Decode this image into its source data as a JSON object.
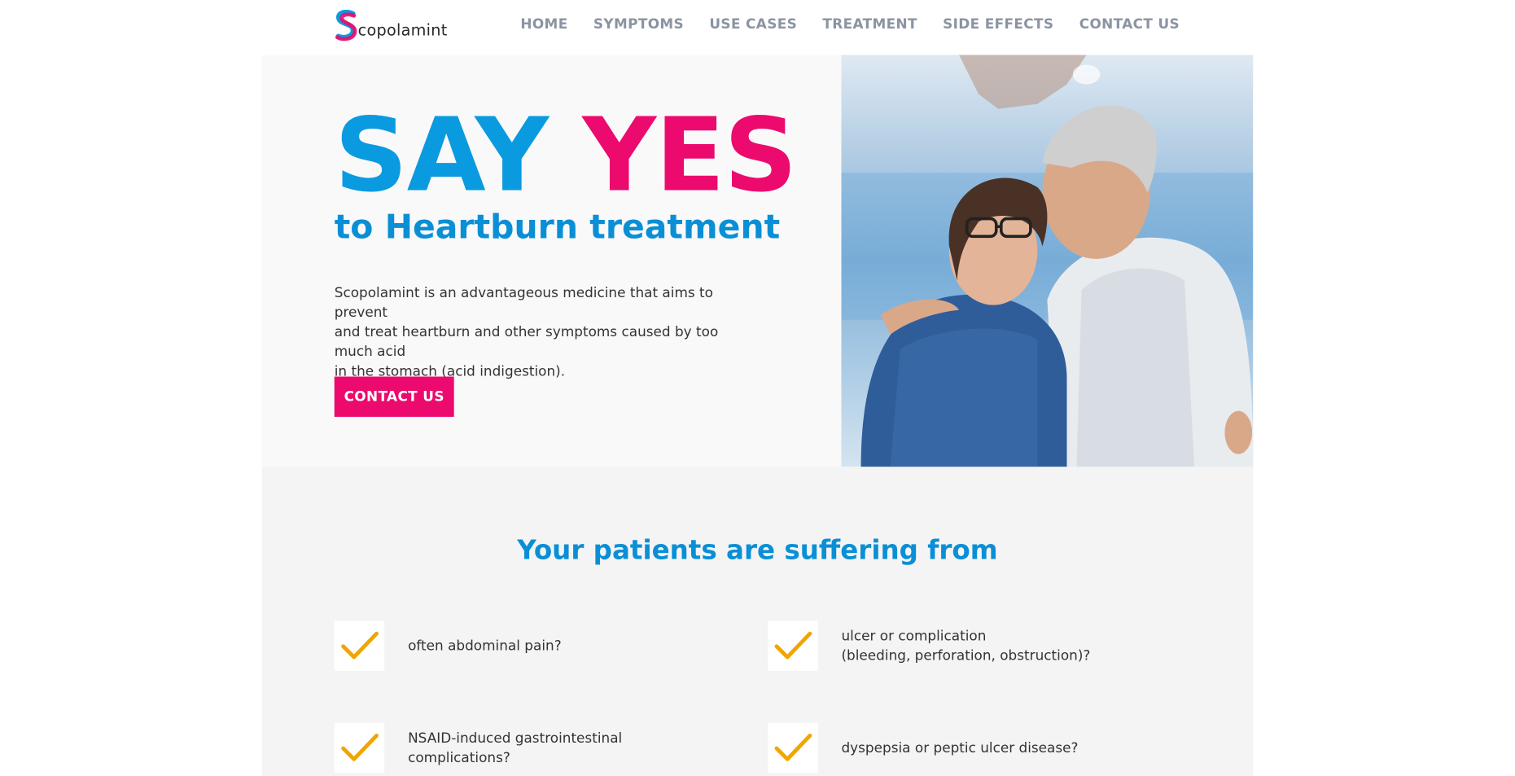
{
  "brand": {
    "name_rest": "copolamint",
    "colors": {
      "blue": "#0a9ae0",
      "pink": "#ec0a6e",
      "check": "#f0a500",
      "nav": "#8a94a2"
    }
  },
  "nav": {
    "items": [
      {
        "label": "HOME"
      },
      {
        "label": "SYMPTOMS"
      },
      {
        "label": "USE CASES"
      },
      {
        "label": "TREATMENT"
      },
      {
        "label": "SIDE EFFECTS"
      },
      {
        "label": "CONTACT US"
      }
    ]
  },
  "hero": {
    "title_say": "SAY",
    "title_yes": "YES",
    "subtitle": "to Heartburn treatment",
    "text_line1": "Scopolamint is an advantageous medicine that aims to prevent",
    "text_line2": "and treat heartburn and other symptoms caused by too much acid",
    "text_line3": "in the stomach (acid indigestion).",
    "cta": "CONTACT US"
  },
  "suffering": {
    "title": "Your patients are suffering from",
    "items": [
      {
        "line1": "often abdominal pain?",
        "line2": ""
      },
      {
        "line1": "ulcer or complication",
        "line2": "(bleeding, perforation, obstruction)?"
      },
      {
        "line1": "NSAID-induced gastrointestinal",
        "line2": "complications?"
      },
      {
        "line1": "dyspepsia or peptic ulcer disease?",
        "line2": ""
      }
    ]
  }
}
